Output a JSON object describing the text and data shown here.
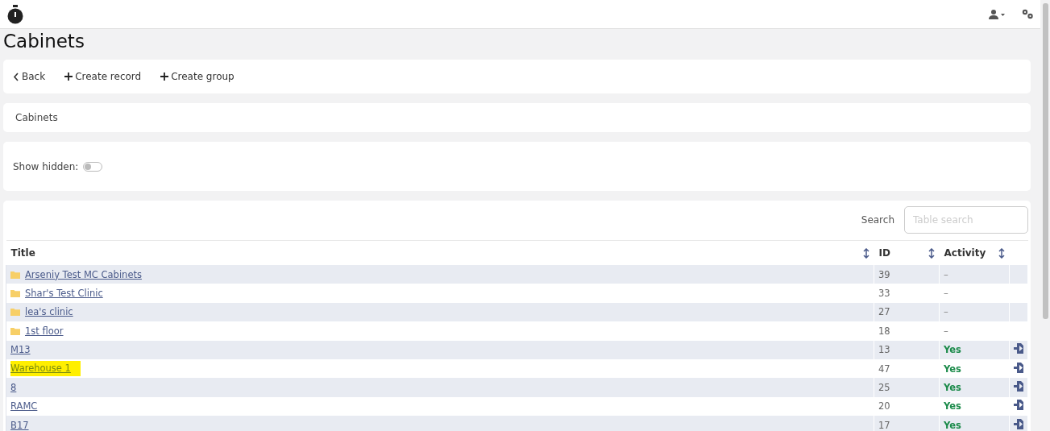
{
  "page_title": "Cabinets",
  "toolbar": [
    {
      "kind": "back",
      "label": "Back"
    },
    {
      "kind": "create",
      "label": "Create record"
    },
    {
      "kind": "create",
      "label": "Create group"
    }
  ],
  "breadcrumb": "Cabinets",
  "filter": {
    "label": "Show hidden:",
    "on": false
  },
  "search": {
    "label": "Search",
    "placeholder": "Table search"
  },
  "table": {
    "columns": [
      "Title",
      "ID",
      "Activity"
    ],
    "rows": [
      {
        "kind": "folder",
        "title": "Arseniy Test MC Cabinets",
        "id": "39",
        "activity": "–",
        "active": false,
        "highlighted": false
      },
      {
        "kind": "folder",
        "title": "Shar's Test Clinic",
        "id": "33",
        "activity": "–",
        "active": false,
        "highlighted": false
      },
      {
        "kind": "folder",
        "title": "lea's clinic",
        "id": "27",
        "activity": "–",
        "active": false,
        "highlighted": false
      },
      {
        "kind": "folder",
        "title": "1st floor",
        "id": "18",
        "activity": "–",
        "active": false,
        "highlighted": false
      },
      {
        "kind": "record",
        "title": "M13",
        "id": "13",
        "activity": "Yes",
        "active": true,
        "highlighted": false
      },
      {
        "kind": "record",
        "title": "Warehouse 1",
        "id": "47",
        "activity": "Yes",
        "active": true,
        "highlighted": true
      },
      {
        "kind": "record",
        "title": "8",
        "id": "25",
        "activity": "Yes",
        "active": true,
        "highlighted": false
      },
      {
        "kind": "record",
        "title": "RAMC",
        "id": "20",
        "activity": "Yes",
        "active": true,
        "highlighted": false
      },
      {
        "kind": "record",
        "title": "B17",
        "id": "17",
        "activity": "Yes",
        "active": true,
        "highlighted": false
      }
    ]
  }
}
